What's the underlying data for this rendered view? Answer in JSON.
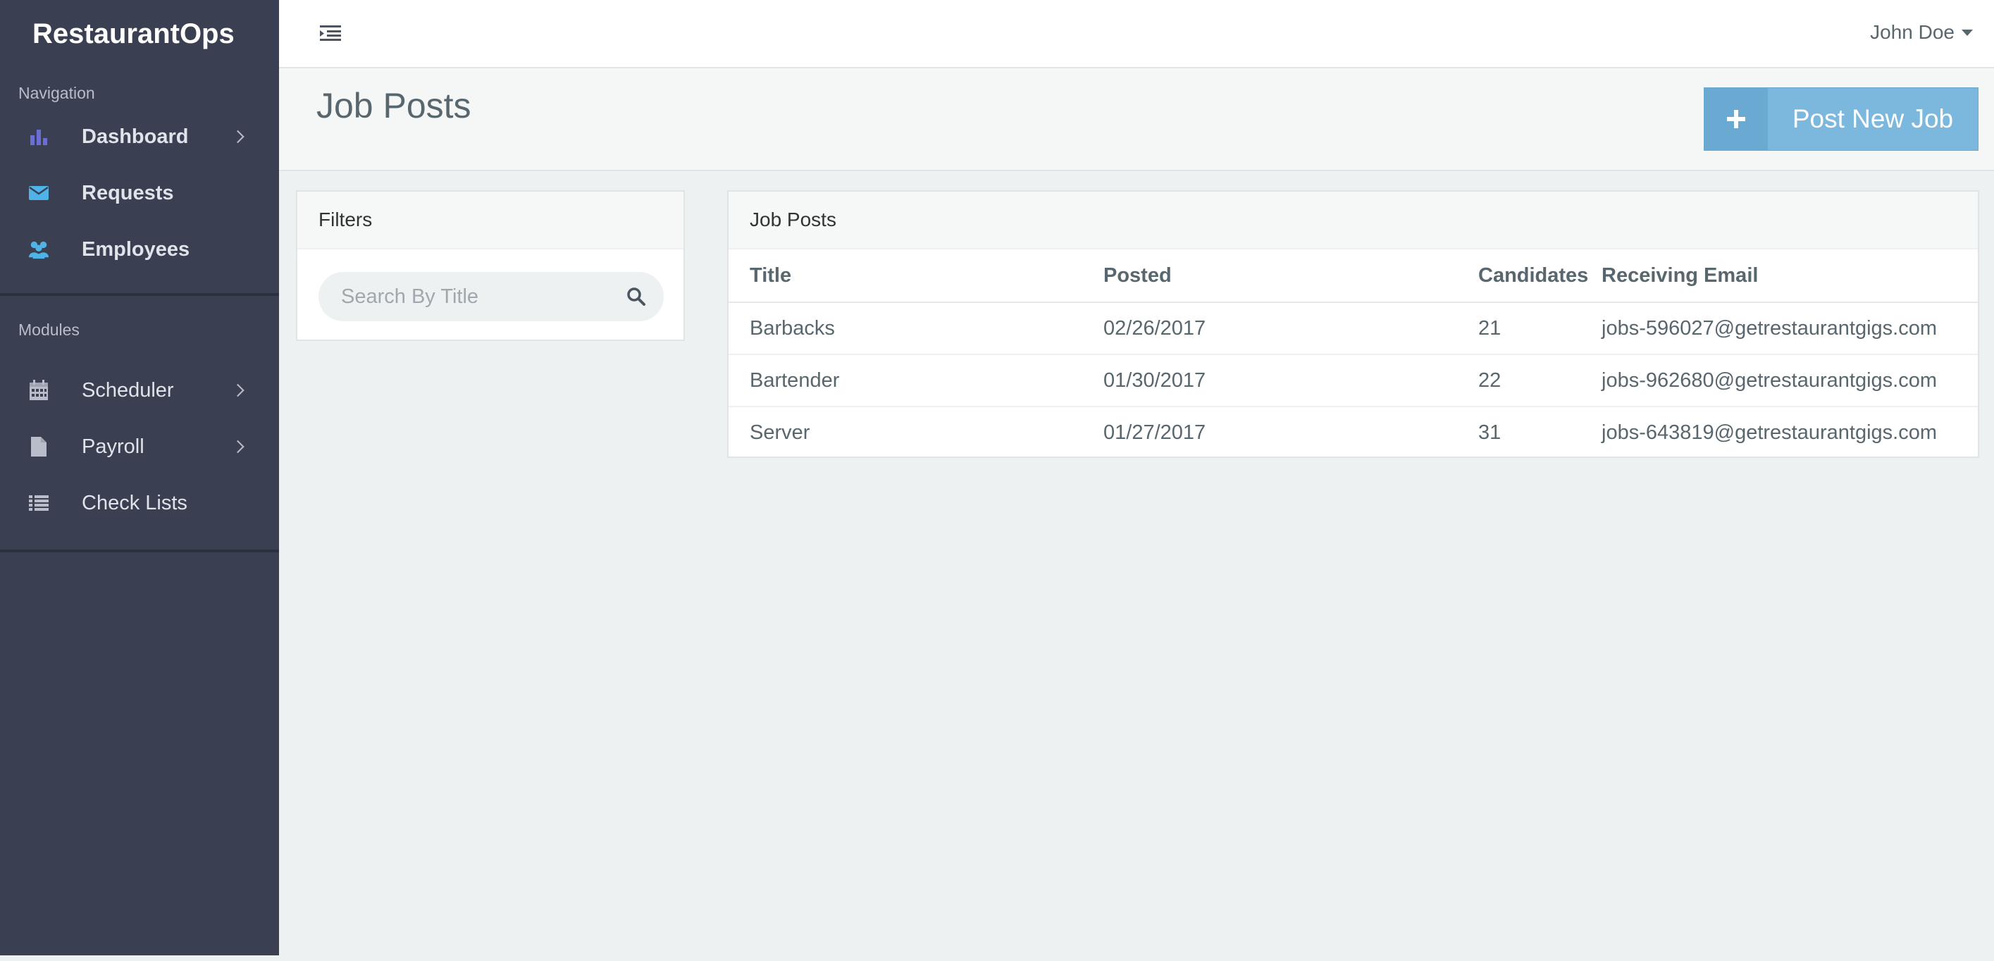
{
  "app": {
    "title": "RestaurantOps"
  },
  "sidebar": {
    "nav_heading": "Navigation",
    "nav_items": [
      {
        "label": "Dashboard",
        "icon": "bar-chart-icon",
        "color": "#6b6fd4",
        "has_chevron": true
      },
      {
        "label": "Requests",
        "icon": "envelope-icon",
        "color": "#4fb3e8",
        "has_chevron": false
      },
      {
        "label": "Employees",
        "icon": "users-icon",
        "color": "#4fb3e8",
        "has_chevron": false
      }
    ],
    "modules_heading": "Modules",
    "module_items": [
      {
        "label": "Scheduler",
        "icon": "calendar-icon",
        "has_chevron": true
      },
      {
        "label": "Payroll",
        "icon": "file-icon",
        "has_chevron": true
      },
      {
        "label": "Check Lists",
        "icon": "list-icon",
        "has_chevron": false
      }
    ]
  },
  "header": {
    "user_name": "John Doe"
  },
  "page": {
    "title": "Job Posts",
    "post_button_label": "Post New Job"
  },
  "filters": {
    "title": "Filters",
    "search_placeholder": "Search By Title"
  },
  "jobs": {
    "title": "Job Posts",
    "columns": [
      "Title",
      "Posted",
      "Candidates",
      "Receiving Email"
    ],
    "rows": [
      {
        "title": "Barbacks",
        "posted": "02/26/2017",
        "candidates": "21",
        "email": "jobs-596027@getrestaurantgigs.com"
      },
      {
        "title": "Bartender",
        "posted": "01/30/2017",
        "candidates": "22",
        "email": "jobs-962680@getrestaurantgigs.com"
      },
      {
        "title": "Server",
        "posted": "01/27/2017",
        "candidates": "31",
        "email": "jobs-643819@getrestaurantgigs.com"
      }
    ]
  },
  "colors": {
    "sidebar_bg": "#3a3f51",
    "accent_button": "#7cb8de",
    "page_bg": "#eef1f2"
  }
}
